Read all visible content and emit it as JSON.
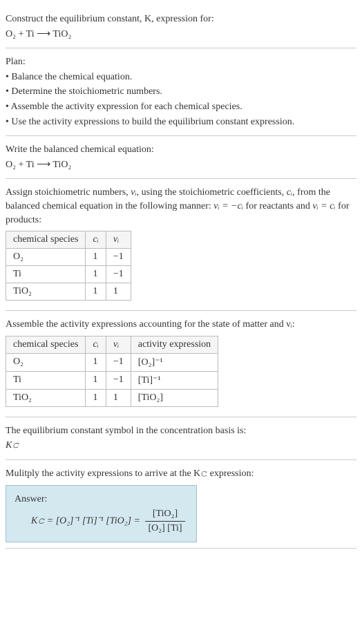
{
  "s1": {
    "l1": "Construct the equilibrium constant, K, expression for:",
    "l2": "O₂ + Ti ⟶ TiO₂"
  },
  "s2": {
    "l1": "Plan:",
    "l2": "• Balance the chemical equation.",
    "l3": "• Determine the stoichiometric numbers.",
    "l4": "• Assemble the activity expression for each chemical species.",
    "l5": "• Use the activity expressions to build the equilibrium constant expression."
  },
  "s3": {
    "l1": "Write the balanced chemical equation:",
    "l2": "O₂ + Ti ⟶ TiO₂"
  },
  "s4": {
    "l1a": "Assign stoichiometric numbers, ",
    "l1b": "νᵢ",
    "l1c": ", using the stoichiometric coefficients, ",
    "l1d": "cᵢ",
    "l1e": ", from the balanced chemical equation in the following manner: ",
    "l1f": "νᵢ = −cᵢ",
    "l1g": " for reactants and ",
    "l1h": "νᵢ = cᵢ",
    "l1i": " for products:",
    "table": {
      "h1": "chemical species",
      "h2": "cᵢ",
      "h3": "νᵢ",
      "rows": [
        {
          "a": "O₂",
          "b": "1",
          "c": "−1"
        },
        {
          "a": "Ti",
          "b": "1",
          "c": "−1"
        },
        {
          "a": "TiO₂",
          "b": "1",
          "c": "1"
        }
      ]
    }
  },
  "s5": {
    "l1": "Assemble the activity expressions accounting for the state of matter and νᵢ:",
    "table": {
      "h1": "chemical species",
      "h2": "cᵢ",
      "h3": "νᵢ",
      "h4": "activity expression",
      "rows": [
        {
          "a": "O₂",
          "b": "1",
          "c": "−1",
          "d": "[O₂]⁻¹"
        },
        {
          "a": "Ti",
          "b": "1",
          "c": "−1",
          "d": "[Ti]⁻¹"
        },
        {
          "a": "TiO₂",
          "b": "1",
          "c": "1",
          "d": "[TiO₂]"
        }
      ]
    }
  },
  "s6": {
    "l1": "The equilibrium constant symbol in the concentration basis is:",
    "l2": "K𝚌"
  },
  "s7": {
    "l1": "Mulitply the activity expressions to arrive at the K𝚌 expression:",
    "ansLabel": "Answer:",
    "eqLeft": "K𝚌 = [O₂]⁻¹ [Ti]⁻¹ [TiO₂] = ",
    "fracNum": "[TiO₂]",
    "fracDen": "[O₂] [Ti]"
  }
}
